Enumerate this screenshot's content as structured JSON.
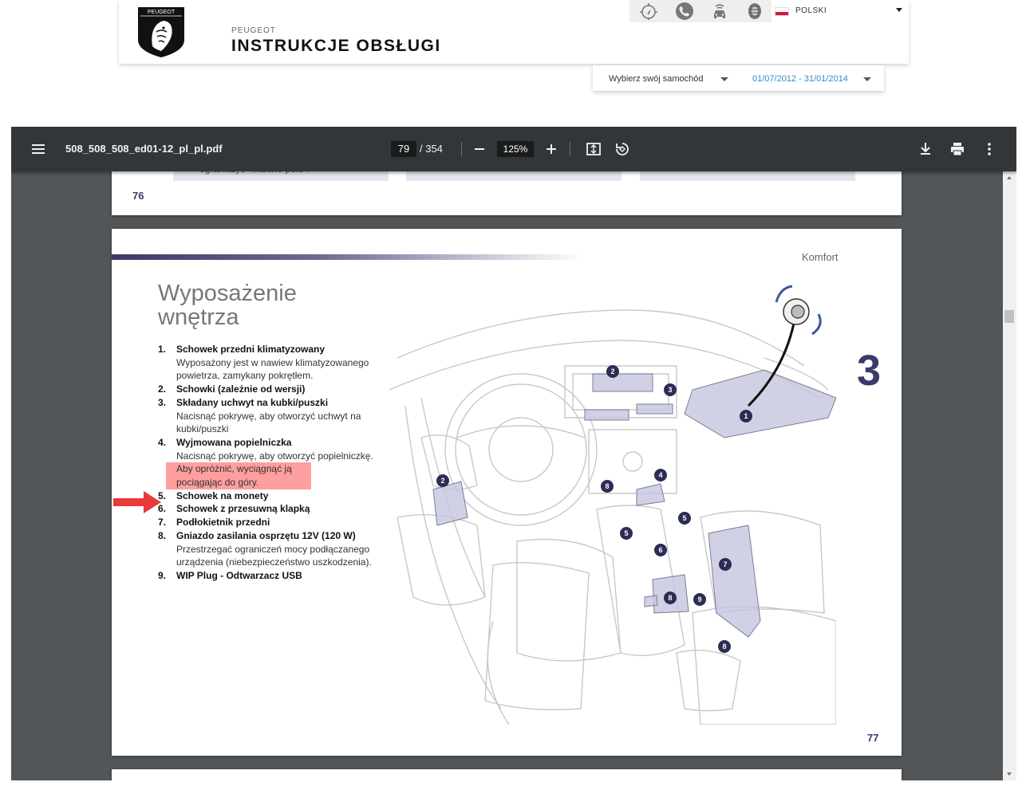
{
  "header": {
    "brand_small": "PEUGEOT",
    "brand_title": "INSTRUKCJE OBSŁUGI",
    "logo_text": "PEUGEOT",
    "icons": [
      "navigation-icon",
      "phone-icon",
      "car-wifi-icon",
      "tire-icon"
    ],
    "language": "POLSKI",
    "car_select": "Wybierz swój samochód",
    "date_range": "01/07/2012 - 31/01/2014"
  },
  "viewer": {
    "file_name": "508_508_508_ed01-12_pl_pl.pdf",
    "current_page": "79",
    "total_pages": "/ 354",
    "zoom": "125%"
  },
  "prev_page": {
    "clipped_text": "ograniczyć \"martwe pole\".",
    "page_number": "76"
  },
  "main_page": {
    "section": "Komfort",
    "heading_line1": "Wyposażenie",
    "heading_line2": "wnętrza",
    "chapter": "3",
    "page_number": "77",
    "items": [
      {
        "n": "1.",
        "title": "Schowek przedni klimatyzowany",
        "desc": "Wyposażony jest w nawiew klimatyzowanego powietrza, zamykany pokrętłem."
      },
      {
        "n": "2.",
        "title": "Schowki (zależnie od wersji)",
        "desc": ""
      },
      {
        "n": "3.",
        "title": "Składany uchwyt na kubki/puszki",
        "desc": "Nacisnąć pokrywę, aby otworzyć uchwyt na kubki/puszki"
      },
      {
        "n": "4.",
        "title": "Wyjmowana popielniczka",
        "desc": "Nacisnąć pokrywę, aby otworzyć popielniczkę.",
        "highlight": "Aby opróżnić, wyciągnąć ją pociągając do góry."
      },
      {
        "n": "5.",
        "title": "Schowek na monety",
        "desc": ""
      },
      {
        "n": "6.",
        "title": "Schowek z przesuwną klapką",
        "desc": ""
      },
      {
        "n": "7.",
        "title": "Podłokietnik przedni",
        "desc": ""
      },
      {
        "n": "8.",
        "title": "Gniazdo zasilania osprzętu 12V (120 W)",
        "desc": "Przestrzegać ograniczeń mocy podłączanego urządzenia (niebezpieczeństwo uszkodzenia)."
      },
      {
        "n": "9.",
        "title": "WIP Plug - Odtwarzacz USB",
        "desc": ""
      }
    ],
    "callouts": [
      "1",
      "2",
      "2",
      "3",
      "4",
      "5",
      "5",
      "6",
      "7",
      "8",
      "8",
      "8",
      "9"
    ]
  },
  "colors": {
    "toolbar": "#323639",
    "viewer_bg": "#525659",
    "accent": "#3b3a6b",
    "highlight": "#ff9e9e",
    "arrow": "#e83a3a",
    "date_link": "#3a8dc9"
  }
}
